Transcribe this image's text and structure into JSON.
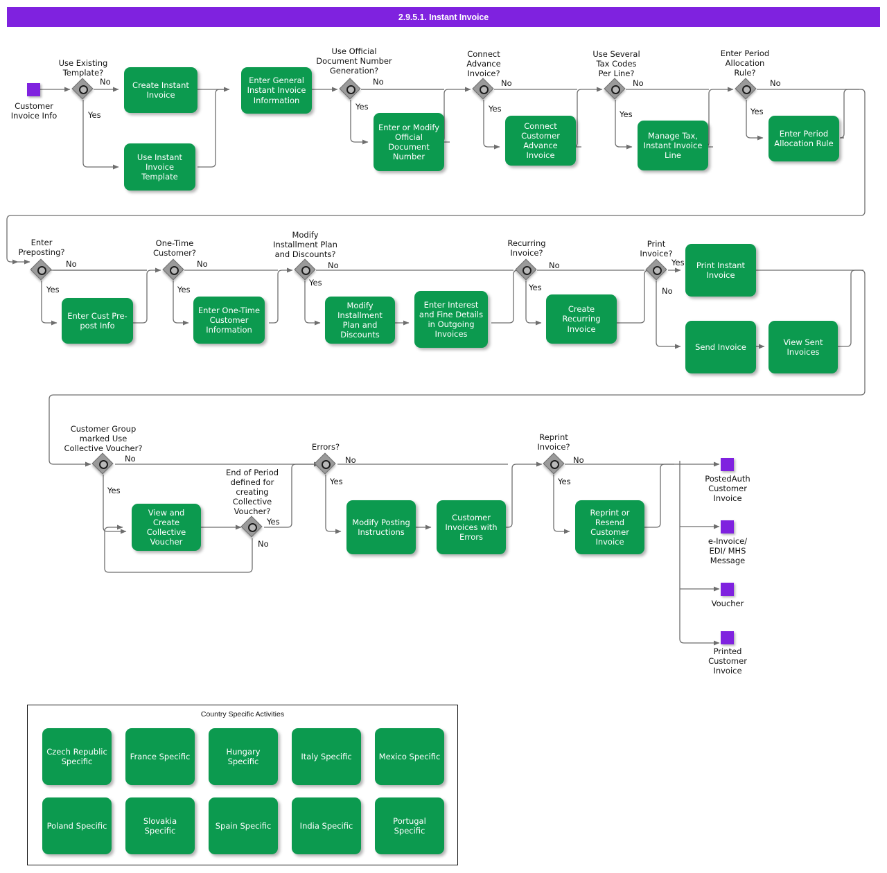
{
  "header": {
    "title": "2.9.5.1. Instant Invoice",
    "bar_color": "#7F22DF"
  },
  "palette": {
    "task_green": "#0C9A4F",
    "event_purple": "#7F22DF",
    "gateway_gray": "#9A9A9A",
    "connector_gray": "#6E6E6E"
  },
  "start_events": [
    {
      "name": "customer-invoice-info",
      "label": "Customer\nInvoice Info"
    }
  ],
  "end_events": [
    {
      "name": "posted-auth-customer-invoice",
      "label": "PostedAuth\nCustomer\nInvoice"
    },
    {
      "name": "e-invoice-edi-mhs-message",
      "label": "e-Invoice/\nEDI/ MHS\nMessage"
    },
    {
      "name": "voucher",
      "label": "Voucher"
    },
    {
      "name": "printed-customer-invoice",
      "label": "Printed\nCustomer\nInvoice"
    }
  ],
  "gateways": [
    {
      "name": "use-existing-template",
      "label": "Use Existing\nTemplate?",
      "yes": "Yes",
      "no": "No"
    },
    {
      "name": "use-official-document-number-generation",
      "label": "Use Official\nDocument Number\nGeneration?",
      "yes": "Yes",
      "no": "No"
    },
    {
      "name": "connect-advance-invoice",
      "label": "Connect\nAdvance\nInvoice?",
      "yes": "Yes",
      "no": "No"
    },
    {
      "name": "use-several-tax-codes-per-line",
      "label": "Use Several\nTax Codes\nPer Line?",
      "yes": "Yes",
      "no": "No"
    },
    {
      "name": "enter-period-allocation-rule",
      "label": "Enter Period\nAllocation\nRule?",
      "yes": "Yes",
      "no": "No"
    },
    {
      "name": "enter-preposting",
      "label": "Enter\nPreposting?",
      "yes": "Yes",
      "no": "No"
    },
    {
      "name": "one-time-customer",
      "label": "One-Time\nCustomer?",
      "yes": "Yes",
      "no": "No"
    },
    {
      "name": "modify-installment-plan-and-discounts",
      "label": "Modify\nInstallment Plan\nand Discounts?",
      "yes": "Yes",
      "no": "No"
    },
    {
      "name": "recurring-invoice",
      "label": "Recurring\nInvoice?",
      "yes": "Yes",
      "no": "No"
    },
    {
      "name": "print-invoice",
      "label": "Print\nInvoice?",
      "yes": "Yes",
      "no": "No"
    },
    {
      "name": "customer-group-marked-use-collective-voucher",
      "label": "Customer Group\nmarked Use\nCollective Voucher?",
      "yes": "Yes",
      "no": "No"
    },
    {
      "name": "end-of-period-defined-for-creating-collective-voucher",
      "label": "End of Period\ndefined for\ncreating\nCollective\nVoucher?",
      "yes": "Yes",
      "no": "No"
    },
    {
      "name": "errors",
      "label": "Errors?",
      "yes": "Yes",
      "no": "No"
    },
    {
      "name": "reprint-invoice",
      "label": "Reprint\nInvoice?",
      "yes": "Yes",
      "no": "No"
    }
  ],
  "tasks": [
    {
      "name": "create-instant-invoice",
      "label": "Create Instant Invoice"
    },
    {
      "name": "use-instant-invoice-template",
      "label": "Use Instant Invoice Template"
    },
    {
      "name": "enter-general-instant-invoice-information",
      "label": "Enter General Instant Invoice Information"
    },
    {
      "name": "enter-or-modify-official-document-number",
      "label": "Enter or Modify Official Document Number"
    },
    {
      "name": "connect-customer-advance-invoice",
      "label": "Connect Customer Advance Invoice"
    },
    {
      "name": "manage-tax-instant-invoice-line",
      "label": "Manage Tax, Instant Invoice Line"
    },
    {
      "name": "enter-period-allocation-rule-task",
      "label": "Enter Period Allocation Rule"
    },
    {
      "name": "enter-cust-prepost-info",
      "label": "Enter Cust Pre-post Info"
    },
    {
      "name": "enter-one-time-customer-information",
      "label": "Enter One-Time Customer Information"
    },
    {
      "name": "modify-installment-plan-and-discounts-task",
      "label": "Modify Installment Plan and Discounts"
    },
    {
      "name": "enter-interest-and-fine-details-in-outgoing-invoices",
      "label": "Enter Interest and Fine Details in Outgoing Invoices"
    },
    {
      "name": "create-recurring-invoice",
      "label": "Create Recurring Invoice"
    },
    {
      "name": "print-instant-invoice",
      "label": "Print Instant Invoice"
    },
    {
      "name": "send-invoice",
      "label": "Send Invoice"
    },
    {
      "name": "view-sent-invoices",
      "label": "View Sent Invoices"
    },
    {
      "name": "view-and-create-collective-voucher",
      "label": "View and Create Collective Voucher"
    },
    {
      "name": "modify-posting-instructions",
      "label": "Modify Posting Instructions"
    },
    {
      "name": "customer-invoices-with-errors",
      "label": "Customer Invoices with Errors"
    },
    {
      "name": "reprint-or-resend-customer-invoice",
      "label": "Reprint or Resend Customer Invoice"
    }
  ],
  "country_group": {
    "title": "Country Specific Activities",
    "items": [
      {
        "name": "czech-republic-specific",
        "label": "Czech Republic Specific"
      },
      {
        "name": "france-specific",
        "label": "France Specific"
      },
      {
        "name": "hungary-specific",
        "label": "Hungary Specific"
      },
      {
        "name": "italy-specific",
        "label": "Italy Specific"
      },
      {
        "name": "mexico-specific",
        "label": "Mexico Specific"
      },
      {
        "name": "poland-specific",
        "label": "Poland Specific"
      },
      {
        "name": "slovakia-specific",
        "label": "Slovakia Specific"
      },
      {
        "name": "spain-specific",
        "label": "Spain Specific"
      },
      {
        "name": "india-specific",
        "label": "India Specific"
      },
      {
        "name": "portugal-specific",
        "label": "Portugal Specific"
      }
    ]
  }
}
